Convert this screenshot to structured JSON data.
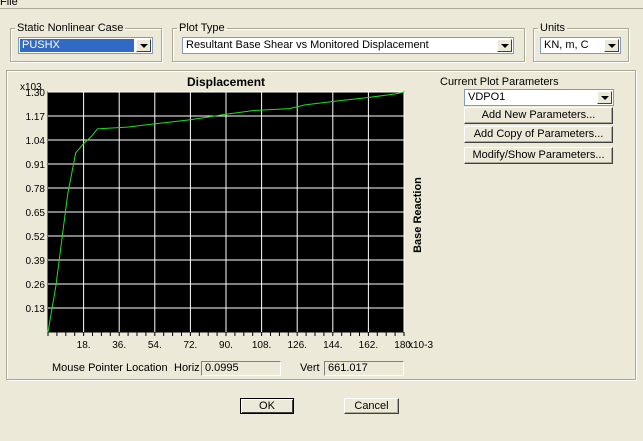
{
  "menu": {
    "file": "File"
  },
  "static_case": {
    "label": "Static Nonlinear Case",
    "value": "PUSHX"
  },
  "plot_type": {
    "label": "Plot Type",
    "value": "Resultant Base Shear vs Monitored Displacement"
  },
  "units": {
    "label": "Units",
    "value": "KN, m, C"
  },
  "params": {
    "label": "Current Plot Parameters",
    "value": "VDPO1",
    "add_new": "Add New Parameters...",
    "add_copy": "Add Copy of Parameters...",
    "modify": "Modify/Show Parameters..."
  },
  "readout": {
    "mouse_label": "Mouse Pointer Location",
    "horiz_label": "Horiz",
    "horiz_value": "0.0995",
    "vert_label": "Vert",
    "vert_value": "661.017"
  },
  "buttons": {
    "ok": "OK",
    "cancel": "Cancel"
  },
  "colors": {
    "plot_bg": "#000000",
    "grid": "#ffffff",
    "curve": "#22dd22",
    "selection": "#316ac5"
  },
  "chart_data": {
    "type": "line",
    "title": "Displacement",
    "ylabel": "Base Reaction",
    "x_multiplier": "x10-3",
    "y_multiplier": "x103",
    "x_ticks": [
      "18.",
      "36.",
      "54.",
      "72.",
      "90.",
      "108.",
      "126.",
      "144.",
      "162.",
      "180."
    ],
    "y_ticks": [
      "1.30",
      "1.17",
      "1.04",
      "0.91",
      "0.78",
      "0.65",
      "0.52",
      "0.39",
      "0.26",
      "0.13"
    ],
    "xlim": [
      0,
      180
    ],
    "ylim": [
      0,
      1.3
    ],
    "grid": true,
    "series": [
      {
        "x": [
          0,
          4,
          7,
          10,
          14,
          18,
          22,
          25,
          40,
          56,
          72,
          90,
          104,
          122,
          130,
          145,
          162,
          176,
          180
        ],
        "y": [
          0,
          0.25,
          0.5,
          0.75,
          0.97,
          1.02,
          1.06,
          1.1,
          1.11,
          1.13,
          1.15,
          1.18,
          1.2,
          1.21,
          1.23,
          1.25,
          1.27,
          1.29,
          1.3
        ]
      }
    ]
  }
}
